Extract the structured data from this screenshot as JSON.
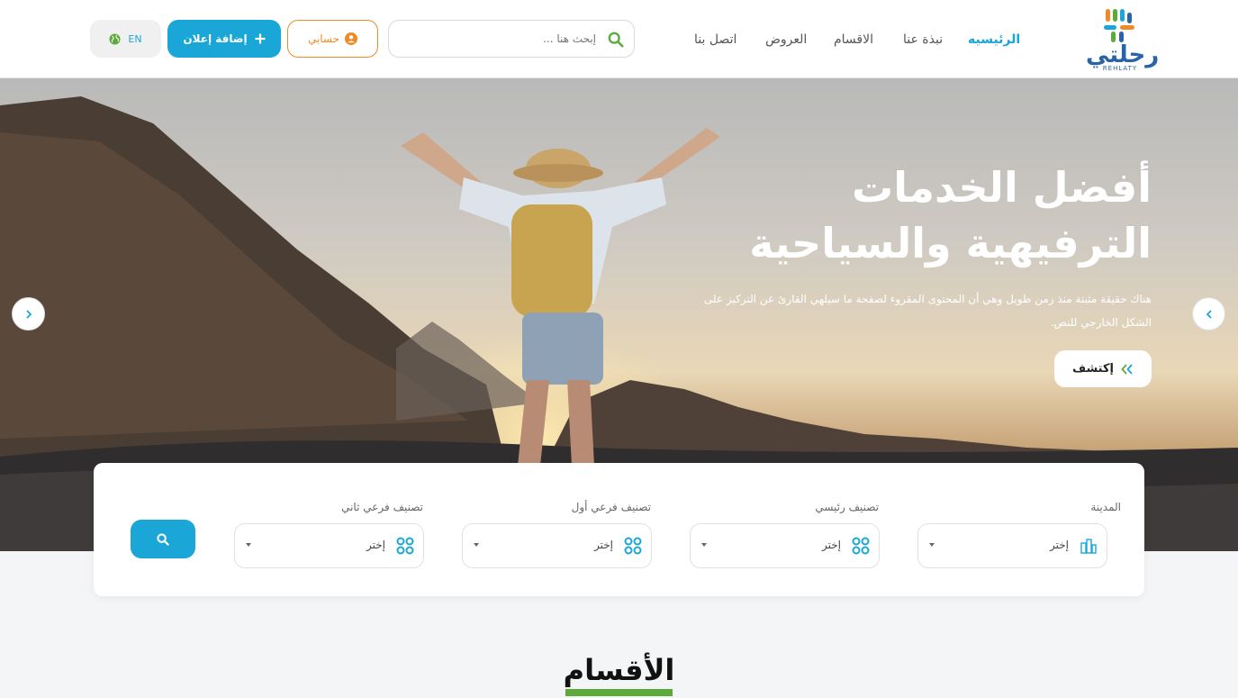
{
  "header": {
    "logo_text": "رحلتي",
    "logo_sub": "REHLATY",
    "nav": [
      {
        "label": "الرئيسيه",
        "active": true
      },
      {
        "label": "نبذة عنا",
        "active": false
      },
      {
        "label": "الاقسام",
        "active": false
      },
      {
        "label": "العروض",
        "active": false
      },
      {
        "label": "اتصل بنا",
        "active": false
      }
    ],
    "search_placeholder": "إبحث هنا ...",
    "account_label": "حسابي",
    "add_ad_label": "إضافة إعلان",
    "lang_label": "EN"
  },
  "hero": {
    "title_line1": "أفضل الخدمات",
    "title_line2": "الترفيهية والسياحية",
    "description": "هناك حقيقة مثبتة منذ زمن طويل وهي أن المحتوى المقروء لصفحة ما سيلهي القارئ عن التركيز على الشكل الخارجي للنص.",
    "explore_label": "إكتشف"
  },
  "filters": {
    "fields": [
      {
        "label": "المدينة",
        "value": "إختر",
        "icon": "city-icon"
      },
      {
        "label": "تصنيف رئيسي",
        "value": "إختر",
        "icon": "category-grid-icon"
      },
      {
        "label": "تصنيف فرعي أول",
        "value": "إختر",
        "icon": "category-grid-icon"
      },
      {
        "label": "تصنيف فرعي ثاني",
        "value": "إختر",
        "icon": "category-grid-icon"
      }
    ]
  },
  "sections": {
    "title": "الأقسام"
  },
  "colors": {
    "primary": "#1aa7d8",
    "accent": "#f08a24",
    "green": "#5caa3a",
    "brand_blue": "#2b63a8"
  }
}
